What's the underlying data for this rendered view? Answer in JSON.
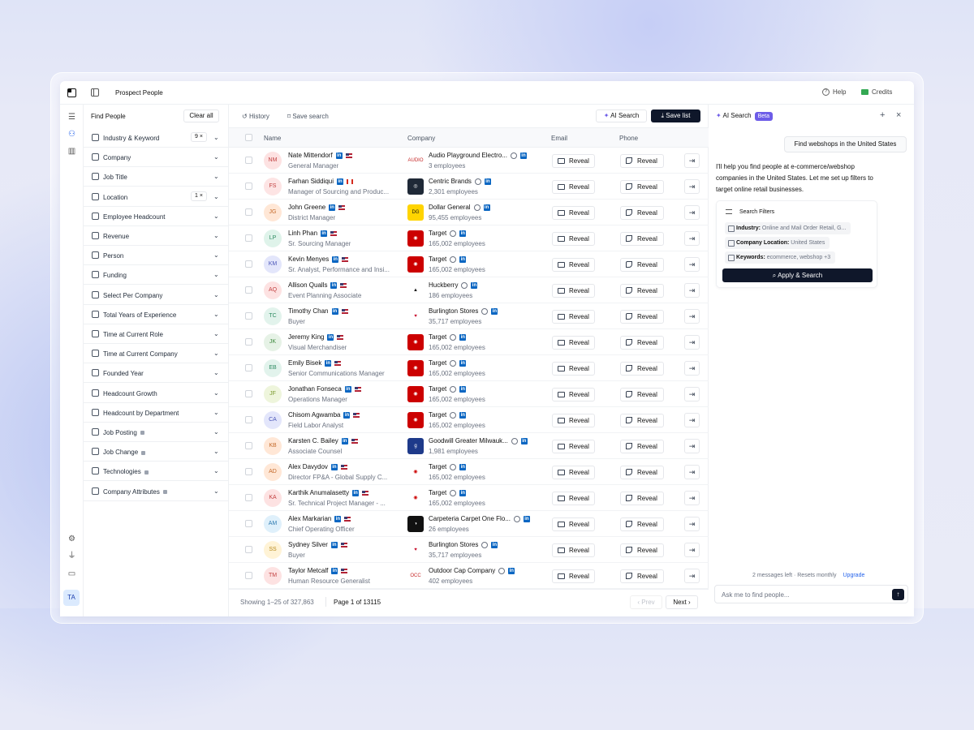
{
  "topbar": {
    "title": "Prospect People",
    "help": "Help",
    "credits": "Credits"
  },
  "filters": {
    "heading": "Find People",
    "clear_all": "Clear all",
    "items": [
      {
        "label": "Industry & Keyword",
        "badge": "9 ×",
        "locked": false
      },
      {
        "label": "Company",
        "badge": "",
        "locked": false
      },
      {
        "label": "Job Title",
        "badge": "",
        "locked": false
      },
      {
        "label": "Location",
        "badge": "1 ×",
        "locked": false
      },
      {
        "label": "Employee Headcount",
        "badge": "",
        "locked": false
      },
      {
        "label": "Revenue",
        "badge": "",
        "locked": false
      },
      {
        "label": "Person",
        "badge": "",
        "locked": false
      },
      {
        "label": "Funding",
        "badge": "",
        "locked": false
      },
      {
        "label": "Select Per Company",
        "badge": "",
        "locked": false
      },
      {
        "label": "Total Years of Experience",
        "badge": "",
        "locked": false
      },
      {
        "label": "Time at Current Role",
        "badge": "",
        "locked": false
      },
      {
        "label": "Time at Current Company",
        "badge": "",
        "locked": false
      },
      {
        "label": "Founded Year",
        "badge": "",
        "locked": false
      },
      {
        "label": "Headcount Growth",
        "badge": "",
        "locked": false
      },
      {
        "label": "Headcount by Department",
        "badge": "",
        "locked": false
      },
      {
        "label": "Job Posting",
        "badge": "",
        "locked": true
      },
      {
        "label": "Job Change",
        "badge": "",
        "locked": true
      },
      {
        "label": "Technologies",
        "badge": "",
        "locked": true
      },
      {
        "label": "Company Attributes",
        "badge": "",
        "locked": true
      }
    ]
  },
  "main": {
    "history": "History",
    "save_search": "Save search",
    "ai_search": "AI Search",
    "save_list": "Save list",
    "columns": {
      "name": "Name",
      "company": "Company",
      "email": "Email",
      "phone": "Phone"
    },
    "reveal": "Reveal",
    "rows": [
      {
        "initials": "NM",
        "name": "Nate Mittendorf",
        "title": "General Manager",
        "flag": "us",
        "company": "Audio Playground Electro...",
        "employees": "3 employees",
        "logo_text": "AUDIO",
        "logo_bg": "#ffffff",
        "logo_fg": "#c62828",
        "avatar_bg": "#fde2e2",
        "avatar_fg": "#c24141"
      },
      {
        "initials": "FS",
        "name": "Farhan Siddiqui",
        "title": "Manager of Sourcing and Produc...",
        "flag": "ca",
        "company": "Centric Brands",
        "employees": "2,301 employees",
        "logo_text": "◎",
        "logo_bg": "#1f2937",
        "logo_fg": "#ffffff",
        "avatar_bg": "#fde4e4",
        "avatar_fg": "#c24141"
      },
      {
        "initials": "JG",
        "name": "John Greene",
        "title": "District Manager",
        "flag": "us",
        "company": "Dollar General",
        "employees": "95,455 employees",
        "logo_text": "DG",
        "logo_bg": "#ffd400",
        "logo_fg": "#111111",
        "avatar_bg": "#ffe7d6",
        "avatar_fg": "#c46a2b"
      },
      {
        "initials": "LP",
        "name": "Linh Phan",
        "title": "Sr. Sourcing Manager",
        "flag": "us",
        "company": "Target",
        "employees": "165,002 employees",
        "logo_text": "◉",
        "logo_bg": "#cc0000",
        "logo_fg": "#ffffff",
        "avatar_bg": "#dff3ea",
        "avatar_fg": "#2e8b62"
      },
      {
        "initials": "KM",
        "name": "Kevin Menyes",
        "title": "Sr. Analyst, Performance and Insi...",
        "flag": "us",
        "company": "Target",
        "employees": "165,002 employees",
        "logo_text": "◉",
        "logo_bg": "#cc0000",
        "logo_fg": "#ffffff",
        "avatar_bg": "#e3e6fb",
        "avatar_fg": "#4b56b8"
      },
      {
        "initials": "AQ",
        "name": "Allison Qualls",
        "title": "Event Planning Associate",
        "flag": "us",
        "company": "Huckberry",
        "employees": "186 employees",
        "logo_text": "▲",
        "logo_bg": "#ffffff",
        "logo_fg": "#111111",
        "avatar_bg": "#fde2e2",
        "avatar_fg": "#c24141"
      },
      {
        "initials": "TC",
        "name": "Timothy Chan",
        "title": "Buyer",
        "flag": "us",
        "company": "Burlington Stores",
        "employees": "35,717 employees",
        "logo_text": "♥",
        "logo_bg": "#ffffff",
        "logo_fg": "#c8102e",
        "avatar_bg": "#e2f3ec",
        "avatar_fg": "#2e8b62"
      },
      {
        "initials": "JK",
        "name": "Jeremy King",
        "title": "Visual Merchandiser",
        "flag": "us",
        "company": "Target",
        "employees": "165,002 employees",
        "logo_text": "◉",
        "logo_bg": "#cc0000",
        "logo_fg": "#ffffff",
        "avatar_bg": "#e6f2e6",
        "avatar_fg": "#3f8a3f"
      },
      {
        "initials": "EB",
        "name": "Emily Bisek",
        "title": "Senior Communications Manager",
        "flag": "us",
        "company": "Target",
        "employees": "165,002 employees",
        "logo_text": "◉",
        "logo_bg": "#cc0000",
        "logo_fg": "#ffffff",
        "avatar_bg": "#e2f3ec",
        "avatar_fg": "#2e8b62"
      },
      {
        "initials": "JF",
        "name": "Jonathan Fonseca",
        "title": "Operations Manager",
        "flag": "us",
        "company": "Target",
        "employees": "165,002 employees",
        "logo_text": "◉",
        "logo_bg": "#cc0000",
        "logo_fg": "#ffffff",
        "avatar_bg": "#eef5dc",
        "avatar_fg": "#7a9a2e"
      },
      {
        "initials": "CA",
        "name": "Chisom Agwamba",
        "title": "Field Labor Analyst",
        "flag": "us",
        "company": "Target",
        "employees": "165,002 employees",
        "logo_text": "◉",
        "logo_bg": "#cc0000",
        "logo_fg": "#ffffff",
        "avatar_bg": "#e3e6fb",
        "avatar_fg": "#4b56b8"
      },
      {
        "initials": "KB",
        "name": "Karsten C. Bailey",
        "title": "Associate Counsel",
        "flag": "us",
        "company": "Goodwill Greater Milwauk...",
        "employees": "1,981 employees",
        "logo_text": "g",
        "logo_bg": "#1e3a8a",
        "logo_fg": "#ffffff",
        "avatar_bg": "#ffe7d6",
        "avatar_fg": "#c46a2b"
      },
      {
        "initials": "AD",
        "name": "Alex Davydov",
        "title": "Director FP&A - Global Supply C...",
        "flag": "us",
        "company": "Target",
        "employees": "165,002 employees",
        "logo_text": "◉",
        "logo_bg": "#ffffff",
        "logo_fg": "#cc0000",
        "avatar_bg": "#ffe7d6",
        "avatar_fg": "#c46a2b"
      },
      {
        "initials": "KA",
        "name": "Karthik Anumalasetty",
        "title": "Sr. Technical Project Manager - ...",
        "flag": "us",
        "company": "Target",
        "employees": "165,002 employees",
        "logo_text": "◉",
        "logo_bg": "#ffffff",
        "logo_fg": "#cc0000",
        "avatar_bg": "#fde2e2",
        "avatar_fg": "#c24141"
      },
      {
        "initials": "AM",
        "name": "Alex Markarian",
        "title": "Chief Operating Officer",
        "flag": "us",
        "company": "Carpeteria Carpet One Flo...",
        "employees": "26 employees",
        "logo_text": "◑",
        "logo_bg": "#111111",
        "logo_fg": "#ffffff",
        "avatar_bg": "#dff0fb",
        "avatar_fg": "#2f7bb0"
      },
      {
        "initials": "SS",
        "name": "Sydney Silver",
        "title": "Buyer",
        "flag": "us",
        "company": "Burlington Stores",
        "employees": "35,717 employees",
        "logo_text": "♥",
        "logo_bg": "#ffffff",
        "logo_fg": "#c8102e",
        "avatar_bg": "#fff3d6",
        "avatar_fg": "#b88a1e"
      },
      {
        "initials": "TM",
        "name": "Taylor Metcalf",
        "title": "Human Resource Generalist",
        "flag": "us",
        "company": "Outdoor Cap Company",
        "employees": "402 employees",
        "logo_text": "OCC",
        "logo_bg": "#ffffff",
        "logo_fg": "#c62828",
        "avatar_bg": "#fde2e2",
        "avatar_fg": "#c24141"
      }
    ],
    "showing": "Showing 1–25 of 327,863",
    "page": "Page 1 of 13115",
    "prev": "‹ Prev",
    "next": "Next ›"
  },
  "panel": {
    "title": "AI Search",
    "beta": "Beta",
    "user_message": "Find webshops in the United States",
    "assistant_message": "I'll help you find people at e-commerce/webshop companies in the United States. Let me set up filters to target online retail businesses.",
    "card_title": "Search Filters",
    "chips": [
      {
        "key": "Industry:",
        "value": "Online and Mail Order Retail, G..."
      },
      {
        "key": "Company Location:",
        "value": "United States"
      },
      {
        "key": "Keywords:",
        "value": "ecommerce, webshop +3"
      }
    ],
    "apply": "Apply & Search",
    "messages_left": "2 messages left · Resets monthly",
    "upgrade": "Upgrade",
    "input_placeholder": "Ask me to find people..."
  },
  "user": {
    "initials": "TA"
  }
}
